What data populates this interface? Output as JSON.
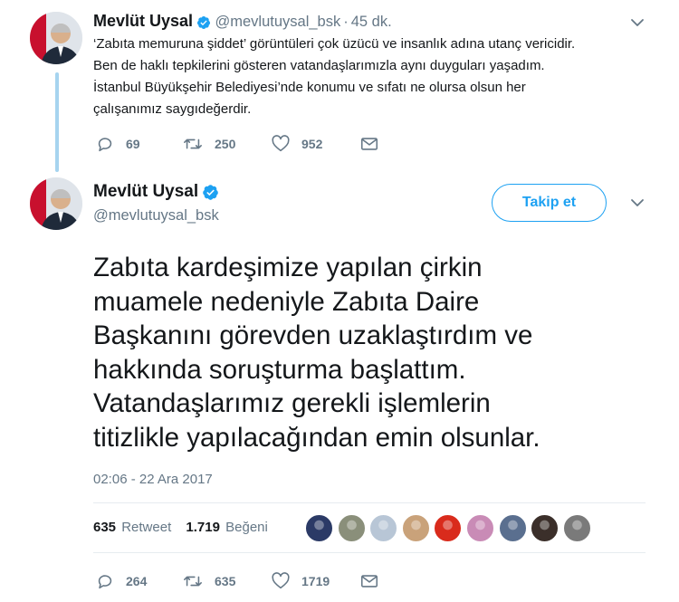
{
  "tweet1": {
    "author_name": "Mevlüt Uysal",
    "handle": "@mevlutuysal_bsk",
    "separator": "·",
    "time_ago": "45 dk.",
    "lines": [
      "‘Zabıta memuruna şiddet’ görüntüleri çok üzücü ve insanlık adına utanç vericidir.",
      "Ben de haklı tepkilerini gösteren vatandaşlarımızla aynı duyguları yaşadım.",
      "İstanbul Büyükşehir Belediyesi’nde konumu ve sıfatı ne olursa olsun her",
      "çalışanımız saygıdeğerdir."
    ],
    "replies": "69",
    "retweets": "250",
    "likes": "952"
  },
  "tweet2": {
    "author_name": "Mevlüt Uysal",
    "handle": "@mevlutuysal_bsk",
    "follow_label": "Takip et",
    "lines": [
      "Zabıta kardeşimize yapılan çirkin",
      "muamele nedeniyle Zabıta Daire",
      "Başkanını görevden uzaklaştırdım ve",
      "hakkında soruşturma başlattım.",
      "Vatandaşlarımız gerekli işlemlerin",
      "titizlikle yapılacağından emin olsunlar."
    ],
    "timestamp": "02:06 - 22 Ara 2017",
    "retweet_count": "635",
    "retweet_label": "Retweet",
    "like_count": "1.719",
    "like_label": "Beğeni",
    "replies": "264",
    "retweets": "635",
    "likes": "1719"
  },
  "colors": {
    "accent": "#1da1f2",
    "text": "#14171a",
    "muted": "#657786",
    "thread_line": "#a6d4ef",
    "likers": [
      "#2b3a66",
      "#8a8f7a",
      "#b8c6d6",
      "#c9a27a",
      "#d92b1c",
      "#c98bb6",
      "#5a6f8f",
      "#3b2f2a",
      "#7a7a7a"
    ]
  },
  "icons": {
    "verified": "verified-badge-icon",
    "caret": "chevron-down-icon",
    "reply": "reply-icon",
    "retweet": "retweet-icon",
    "like": "heart-icon",
    "dm": "envelope-icon"
  }
}
